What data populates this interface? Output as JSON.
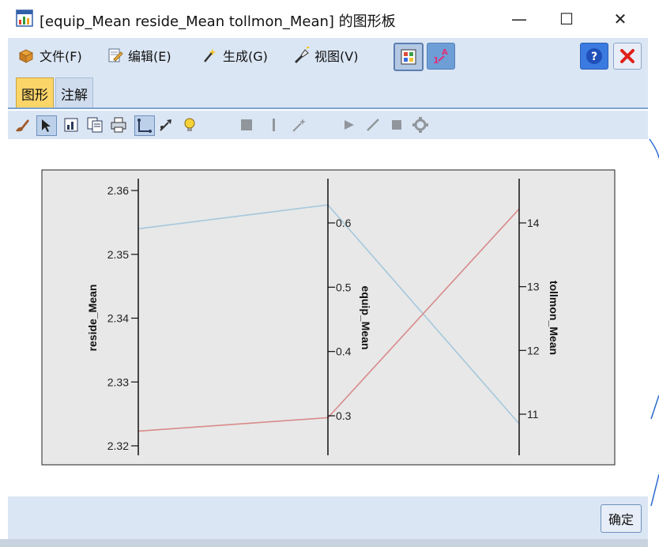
{
  "window": {
    "title": "[equip_Mean reside_Mean tollmon_Mean] 的图形板",
    "minimize_glyph": "—",
    "maximize_glyph": "☐",
    "close_glyph": "✕"
  },
  "menu": {
    "file": "文件(F)",
    "edit": "编辑(E)",
    "generate": "生成(G)",
    "view": "视图(V)"
  },
  "tabs": {
    "graph": "图形",
    "notes": "注解"
  },
  "footer": {
    "ok": "确定"
  },
  "colors": {
    "series_blue": "#a5c8dc",
    "series_red": "#d98a8a",
    "plot_bg": "#e8e8e8",
    "chrome_bg": "#dbe6f4"
  },
  "chart_data": {
    "type": "line",
    "title": "",
    "axes": [
      {
        "name": "reside_Mean",
        "ticks": [
          "2.32",
          "2.33",
          "2.34",
          "2.35",
          "2.36"
        ],
        "range": [
          2.32,
          2.36
        ]
      },
      {
        "name": "equip_Mean",
        "ticks": [
          "0.3",
          "0.4",
          "0.5",
          "0.6"
        ],
        "range": [
          0.3,
          0.6
        ]
      },
      {
        "name": "tollmon_Mean",
        "ticks": [
          "11",
          "12",
          "13",
          "14"
        ],
        "range": [
          11,
          14
        ]
      }
    ],
    "series": [
      {
        "color": "#a5c8dc",
        "values": [
          2.354,
          0.628,
          10.85
        ]
      },
      {
        "color": "#d98a8a",
        "values": [
          2.3223,
          0.297,
          14.22
        ]
      }
    ],
    "grid": false,
    "legend": "none"
  }
}
